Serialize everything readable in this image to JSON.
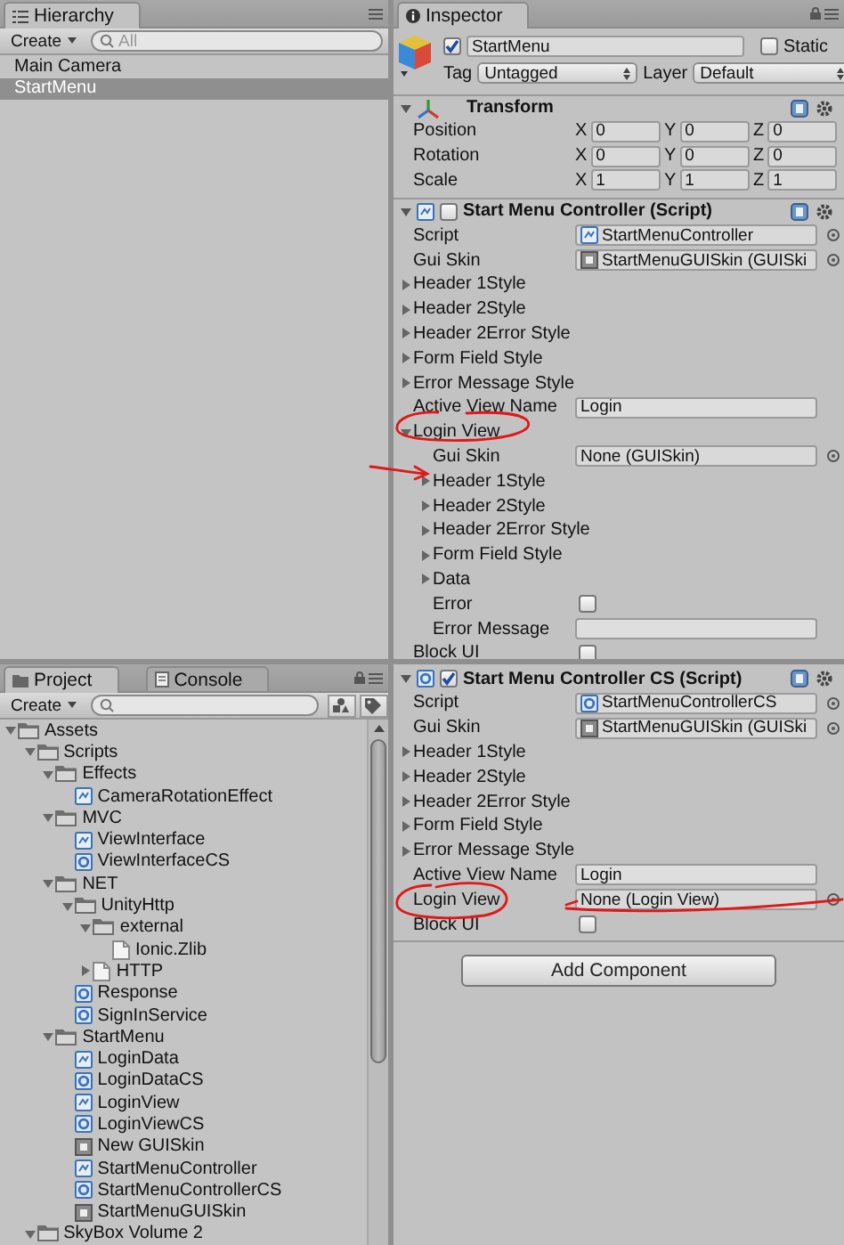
{
  "hierarchy": {
    "tab": "Hierarchy",
    "create_button": "Create",
    "search": {
      "placeholder": "All"
    },
    "items": [
      {
        "label": "Main Camera",
        "selected": false
      },
      {
        "label": "StartMenu",
        "selected": true
      }
    ]
  },
  "inspector": {
    "tab": "Inspector",
    "object": {
      "active": true,
      "name": "StartMenu",
      "static": false,
      "static_label": "Static",
      "tag_label": "Tag",
      "tag": "Untagged",
      "layer_label": "Layer",
      "layer": "Default"
    },
    "components": [
      {
        "kind": "transform",
        "title": "Transform",
        "expanded": true,
        "rows": [
          {
            "label": "Position",
            "axes": [
              {
                "axis": "X",
                "value": "0"
              },
              {
                "axis": "Y",
                "value": "0"
              },
              {
                "axis": "Z",
                "value": "0"
              }
            ]
          },
          {
            "label": "Rotation",
            "axes": [
              {
                "axis": "X",
                "value": "0"
              },
              {
                "axis": "Y",
                "value": "0"
              },
              {
                "axis": "Z",
                "value": "0"
              }
            ]
          },
          {
            "label": "Scale",
            "axes": [
              {
                "axis": "X",
                "value": "1"
              },
              {
                "axis": "Y",
                "value": "1"
              },
              {
                "axis": "Z",
                "value": "1"
              }
            ]
          }
        ]
      },
      {
        "kind": "js_script",
        "enabled": false,
        "title": "Start Menu Controller (Script)",
        "expanded": true,
        "fields": [
          {
            "kind": "js_ref",
            "label": "Script",
            "value": "StartMenuController"
          },
          {
            "kind": "skin_ref",
            "label": "Gui Skin",
            "value": "StartMenuGUISkin (GUISki"
          },
          {
            "kind": "foldout",
            "label": "Header 1Style",
            "expanded": false
          },
          {
            "kind": "foldout",
            "label": "Header 2Style",
            "expanded": false
          },
          {
            "kind": "foldout",
            "label": "Header 2Error Style",
            "expanded": false
          },
          {
            "kind": "foldout",
            "label": "Form Field Style",
            "expanded": false
          },
          {
            "kind": "foldout",
            "label": "Error Message Style",
            "expanded": false
          },
          {
            "kind": "text",
            "label": "Active View Name",
            "value": "Login"
          },
          {
            "kind": "group",
            "label": "Login View",
            "expanded": true,
            "children": [
              {
                "kind": "object",
                "label": "Gui Skin",
                "value": "None (GUISkin)"
              },
              {
                "kind": "foldout",
                "label": "Header 1Style",
                "expanded": false
              },
              {
                "kind": "foldout",
                "label": "Header 2Style",
                "expanded": false
              },
              {
                "kind": "foldout",
                "label": "Header 2Error Style",
                "expanded": false
              },
              {
                "kind": "foldout",
                "label": "Form Field Style",
                "expanded": false
              },
              {
                "kind": "foldout",
                "label": "Data",
                "expanded": false
              },
              {
                "kind": "checkbox",
                "label": "Error",
                "checked": false
              },
              {
                "kind": "text",
                "label": "Error Message"
              }
            ]
          },
          {
            "kind": "checkbox",
            "label": "Block UI",
            "checked": false
          }
        ]
      }
    ]
  },
  "inspector_lower": {
    "components": [
      {
        "kind": "cs_script",
        "enabled": true,
        "title": "Start Menu Controller CS (Script)",
        "expanded": true,
        "fields": [
          {
            "kind": "cs_ref",
            "label": "Script",
            "value": "StartMenuControllerCS"
          },
          {
            "kind": "skin_ref",
            "label": "Gui Skin",
            "value": "StartMenuGUISkin (GUISki"
          },
          {
            "kind": "foldout",
            "label": "Header 1Style",
            "expanded": false
          },
          {
            "kind": "foldout",
            "label": "Header 2Style",
            "expanded": false
          },
          {
            "kind": "foldout",
            "label": "Header 2Error Style",
            "expanded": false
          },
          {
            "kind": "foldout",
            "label": "Form Field Style",
            "expanded": false
          },
          {
            "kind": "foldout",
            "label": "Error Message Style",
            "expanded": false
          },
          {
            "kind": "text",
            "label": "Active View Name",
            "value": "Login"
          },
          {
            "kind": "object",
            "label": "Login View",
            "value": "None (Login View)"
          },
          {
            "kind": "checkbox",
            "label": "Block UI",
            "checked": false
          }
        ]
      }
    ],
    "add_component_button": "Add Component"
  },
  "project": {
    "tabs": [
      {
        "label": "Project",
        "selected": true
      },
      {
        "label": "Console",
        "selected": false
      }
    ],
    "create_button": "Create",
    "tree": [
      {
        "label": "Assets",
        "kind": "folder",
        "expanded": true,
        "children": [
          {
            "label": "Scripts",
            "kind": "folder",
            "expanded": true,
            "children": [
              {
                "label": "Effects",
                "kind": "folder",
                "expanded": true,
                "children": [
                  {
                    "label": "CameraRotationEffect",
                    "kind": "js"
                  }
                ]
              },
              {
                "label": "MVC",
                "kind": "folder",
                "expanded": true,
                "children": [
                  {
                    "label": "ViewInterface",
                    "kind": "js"
                  },
                  {
                    "label": "ViewInterfaceCS",
                    "kind": "cs"
                  }
                ]
              },
              {
                "label": "NET",
                "kind": "folder",
                "expanded": true,
                "children": [
                  {
                    "label": "UnityHttp",
                    "kind": "folder",
                    "expanded": true,
                    "children": [
                      {
                        "label": "external",
                        "kind": "folder",
                        "expanded": true,
                        "children": [
                          {
                            "label": "Ionic.Zlib",
                            "kind": "file"
                          }
                        ]
                      },
                      {
                        "label": "HTTP",
                        "kind": "file",
                        "expanded": false
                      }
                    ]
                  },
                  {
                    "label": "Response",
                    "kind": "cs"
                  },
                  {
                    "label": "SignInService",
                    "kind": "cs"
                  }
                ]
              },
              {
                "label": "StartMenu",
                "kind": "folder",
                "expanded": true,
                "children": [
                  {
                    "label": "LoginData",
                    "kind": "js"
                  },
                  {
                    "label": "LoginDataCS",
                    "kind": "cs"
                  },
                  {
                    "label": "LoginView",
                    "kind": "js"
                  },
                  {
                    "label": "LoginViewCS",
                    "kind": "cs"
                  },
                  {
                    "label": "New GUISkin",
                    "kind": "skin"
                  },
                  {
                    "label": "StartMenuController",
                    "kind": "js"
                  },
                  {
                    "label": "StartMenuControllerCS",
                    "kind": "cs"
                  },
                  {
                    "label": "StartMenuGUISkin",
                    "kind": "skin"
                  }
                ]
              }
            ]
          },
          {
            "label": "SkyBox Volume 2",
            "kind": "folder",
            "expanded": true
          }
        ]
      }
    ]
  }
}
